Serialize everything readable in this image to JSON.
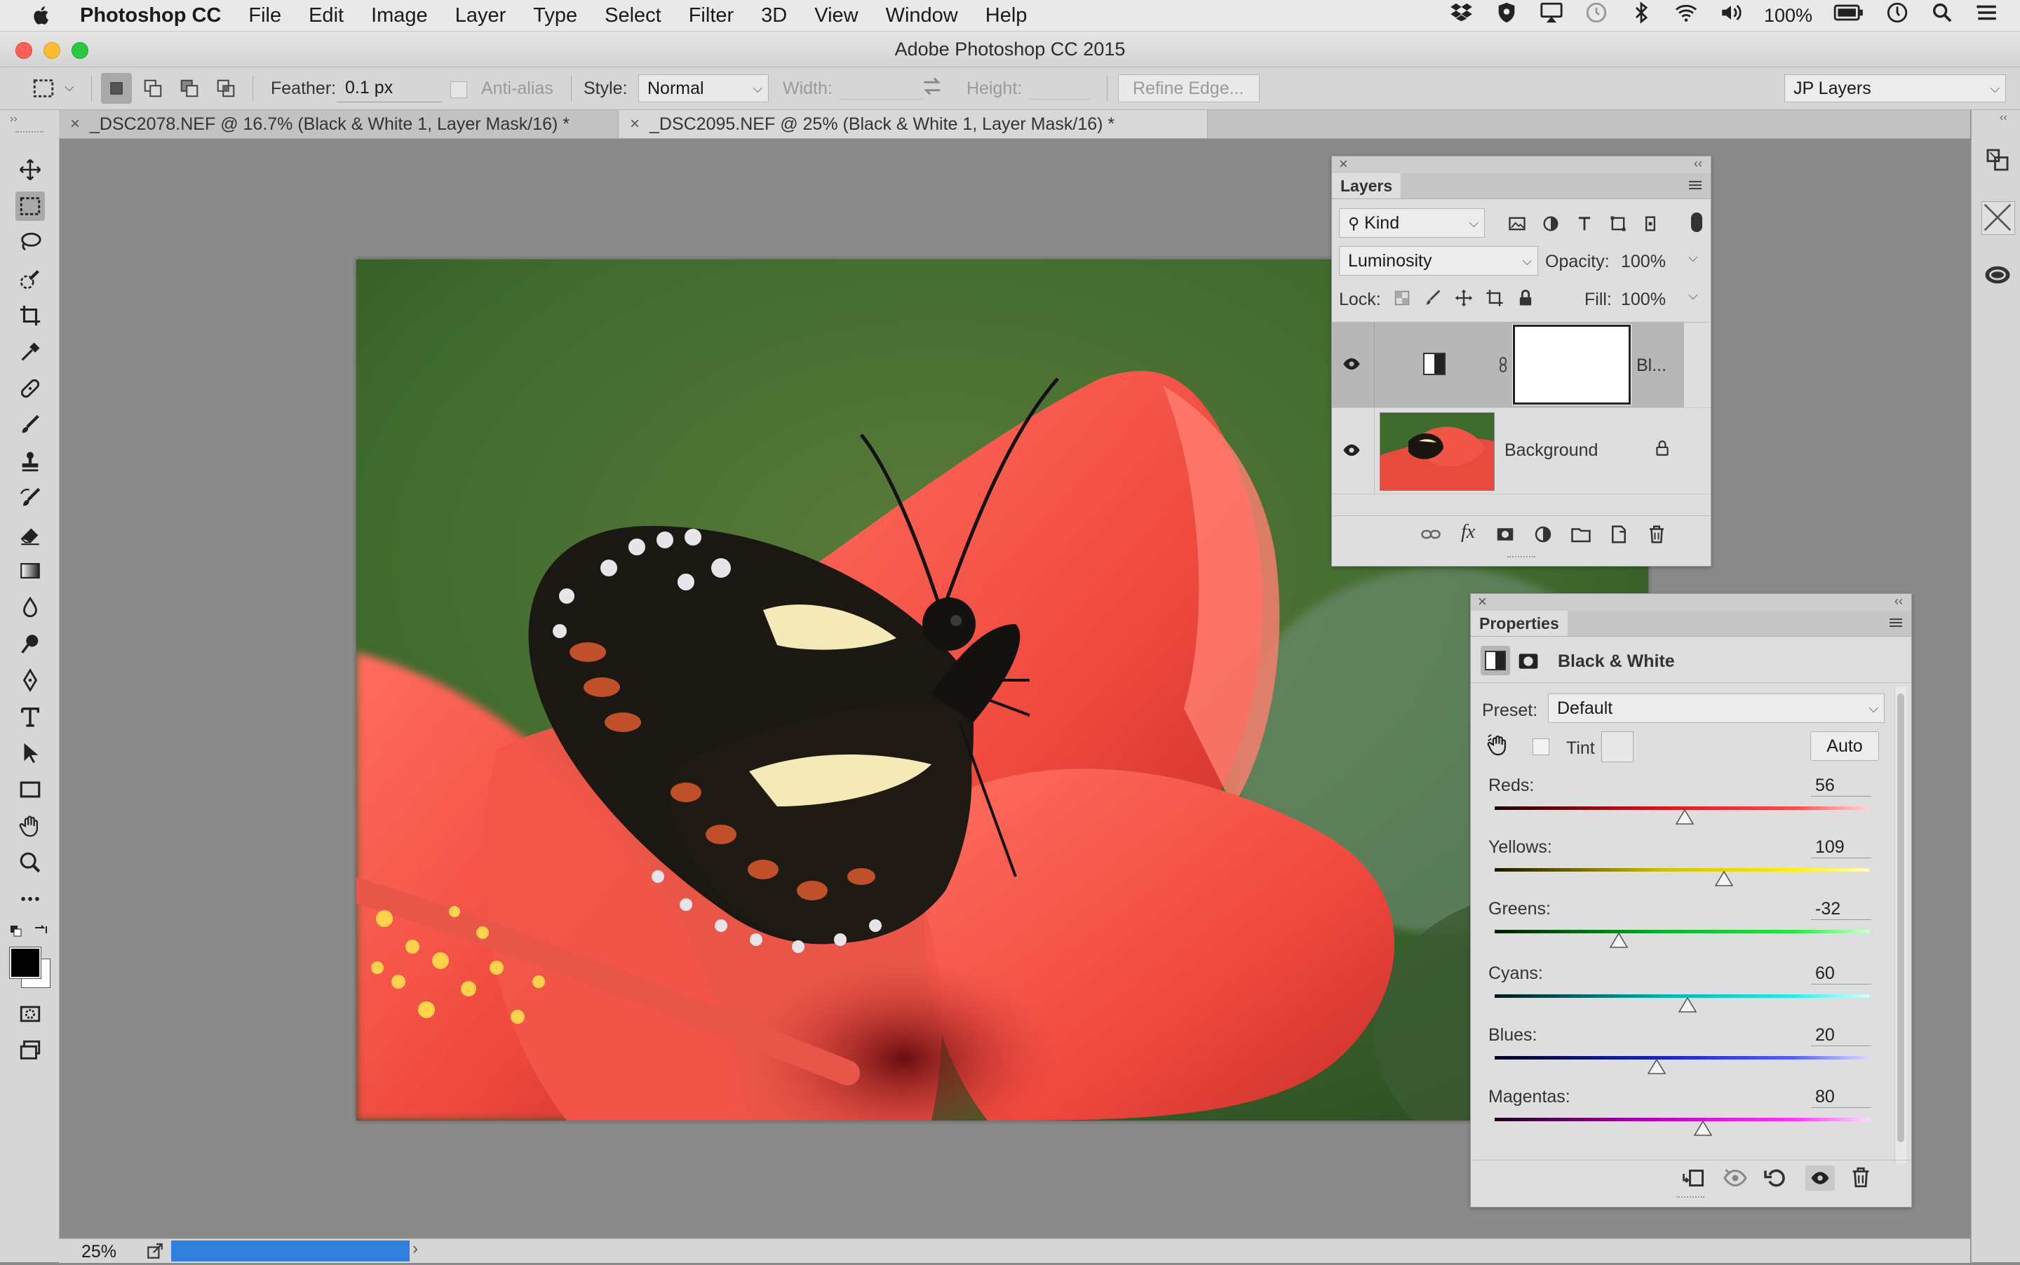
{
  "menubar": {
    "app_name": "Photoshop CC",
    "items": [
      "File",
      "Edit",
      "Image",
      "Layer",
      "Type",
      "Select",
      "Filter",
      "3D",
      "View",
      "Window",
      "Help"
    ],
    "battery": "100%"
  },
  "window": {
    "title": "Adobe Photoshop CC 2015"
  },
  "options": {
    "feather_label": "Feather:",
    "feather_value": "0.1 px",
    "antialias_label": "Anti-alias",
    "style_label": "Style:",
    "style_value": "Normal",
    "width_label": "Width:",
    "height_label": "Height:",
    "refine_edge": "Refine Edge...",
    "workspace": "JP Layers"
  },
  "tabs": [
    {
      "label": "_DSC2078.NEF @ 16.7% (Black & White 1, Layer Mask/16) *",
      "close": "×"
    },
    {
      "label": "_DSC2095.NEF @ 25% (Black & White 1, Layer Mask/16) *",
      "close": "×"
    }
  ],
  "layers_panel": {
    "title": "Layers",
    "close": "×",
    "collapse": "‹‹",
    "filter_kind": "Kind",
    "blend_mode": "Luminosity",
    "opacity_label": "Opacity:",
    "opacity_value": "100%",
    "lock_label": "Lock:",
    "fill_label": "Fill:",
    "fill_value": "100%",
    "layers": [
      {
        "name": "Bl..."
      },
      {
        "name": "Background"
      }
    ],
    "fx_label": "fx"
  },
  "properties_panel": {
    "title": "Properties",
    "close": "×",
    "collapse": "‹‹",
    "adjustment_name": "Black & White",
    "preset_label": "Preset:",
    "preset_value": "Default",
    "tint_label": "Tint",
    "auto_label": "Auto",
    "sliders": [
      {
        "label": "Reds:",
        "value": "56"
      },
      {
        "label": "Yellows:",
        "value": "109"
      },
      {
        "label": "Greens:",
        "value": "-32"
      },
      {
        "label": "Cyans:",
        "value": "60"
      },
      {
        "label": "Blues:",
        "value": "20"
      },
      {
        "label": "Magentas:",
        "value": "80"
      }
    ]
  },
  "status": {
    "zoom": "25%"
  },
  "colors": {
    "accent": "#2f7fdc",
    "panel_bg": "#dedede",
    "canvas_bg": "#8a8a8a"
  }
}
